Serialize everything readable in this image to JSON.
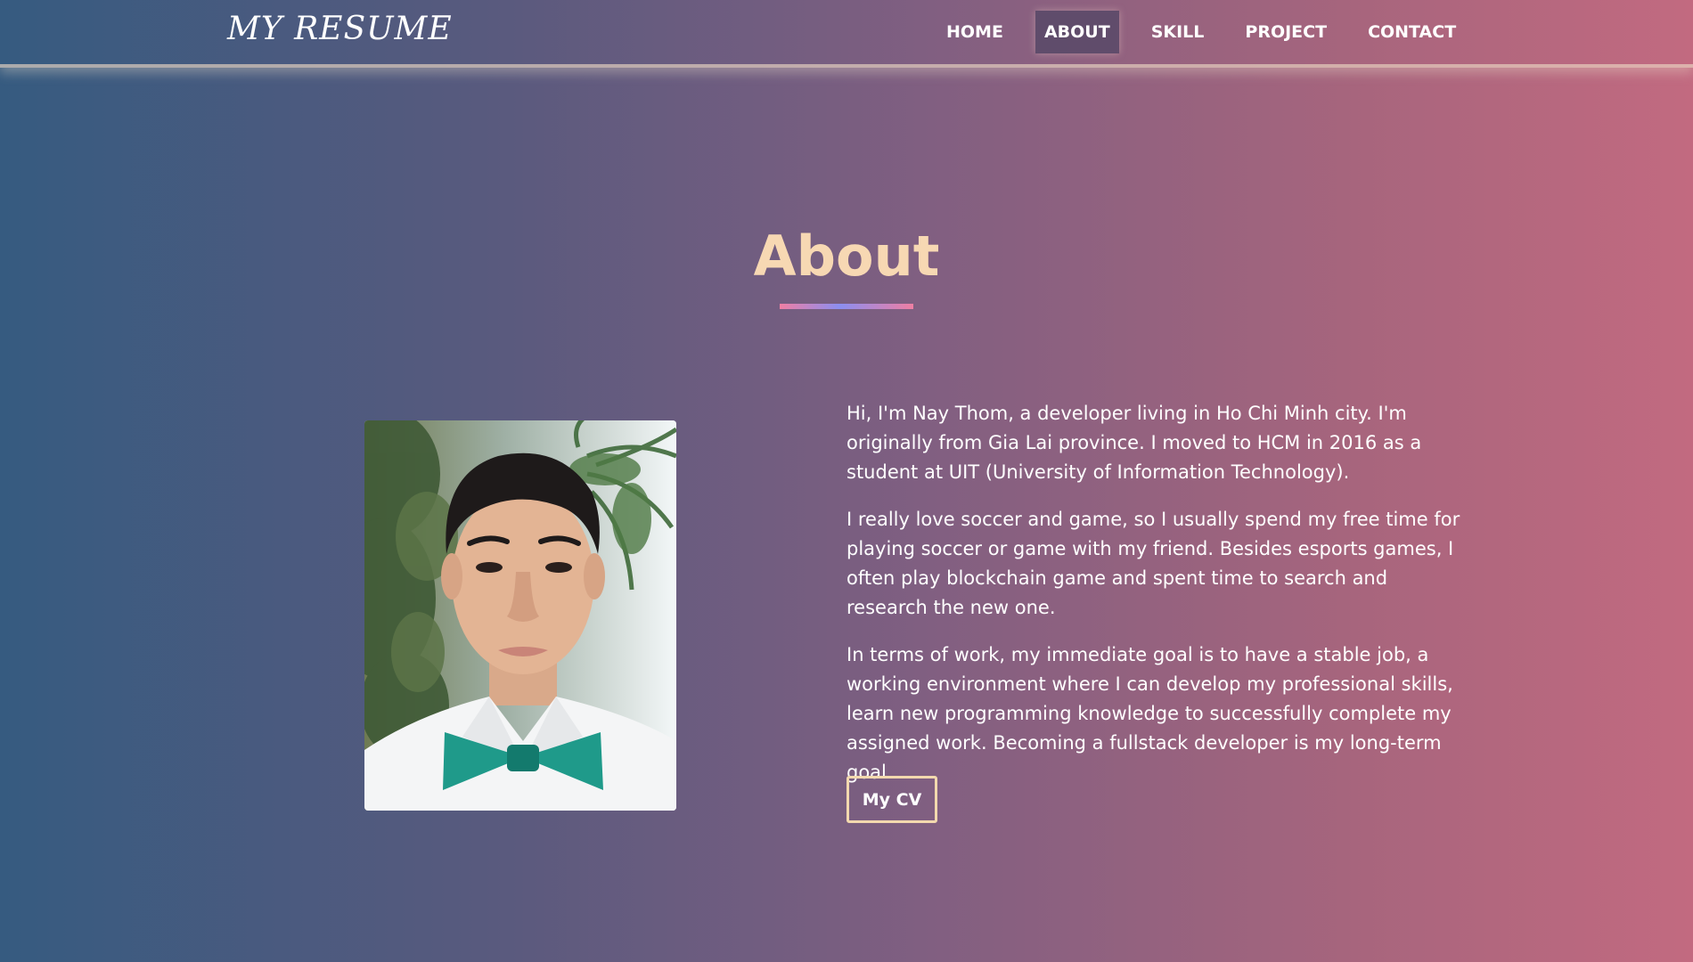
{
  "header": {
    "logo": "MY RESUME",
    "nav": [
      {
        "label": "HOME"
      },
      {
        "label": "ABOUT"
      },
      {
        "label": "SKILL"
      },
      {
        "label": "PROJECT"
      },
      {
        "label": "CONTACT"
      }
    ],
    "active_nav": "ABOUT"
  },
  "about": {
    "title": "About",
    "photo_icon": "profile-photo",
    "paragraphs": [
      "Hi, I'm Nay Thom, a developer living in Ho Chi Minh city. I'm originally from Gia Lai province. I moved to HCM in 2016 as a student at UIT (University of Information Technology).",
      "I really love soccer and game, so I usually spend my free time for playing soccer or game with my friend. Besides esports games, I often play blockchain game and spent time to search and research the new one.",
      "In terms of work, my immediate goal is to have a stable job, a working environment where I can develop my professional skills, learn new programming knowledge to successfully complete my assigned work. Becoming a fullstack developer is my long-term goal."
    ],
    "cv_button": "My CV"
  },
  "colors": {
    "title": "#f7d8b3",
    "button_border": "#f3d9ae",
    "gradient_left": "#365b80",
    "gradient_right": "#c26a80"
  }
}
